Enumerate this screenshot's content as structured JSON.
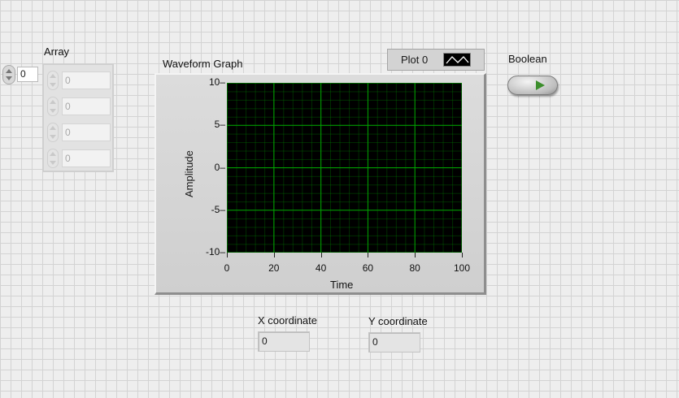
{
  "array": {
    "label": "Array",
    "index_value": "0",
    "elements": [
      "0",
      "0",
      "0",
      "0"
    ]
  },
  "graph": {
    "title": "Waveform Graph",
    "legend_label": "Plot 0",
    "ylabel": "Amplitude",
    "xlabel": "Time",
    "y_ticks": [
      "10",
      "5",
      "0",
      "-5",
      "-10"
    ],
    "x_ticks": [
      "0",
      "20",
      "40",
      "60",
      "80",
      "100"
    ]
  },
  "boolean": {
    "label": "Boolean"
  },
  "x_coord": {
    "label": "X coordinate",
    "value": "0"
  },
  "y_coord": {
    "label": "Y coordinate",
    "value": "0"
  },
  "colors": {
    "plot_bg": "#000000",
    "grid": "#00a000",
    "led": "#3c8e2c"
  },
  "chart_data": {
    "type": "line",
    "title": "Waveform Graph",
    "xlabel": "Time",
    "ylabel": "Amplitude",
    "xlim": [
      0,
      100
    ],
    "ylim": [
      -10,
      10
    ],
    "x_ticks": [
      0,
      20,
      40,
      60,
      80,
      100
    ],
    "y_ticks": [
      10,
      5,
      0,
      -5,
      -10
    ],
    "grid": true,
    "series": [
      {
        "name": "Plot 0",
        "x": [],
        "y": []
      }
    ]
  }
}
